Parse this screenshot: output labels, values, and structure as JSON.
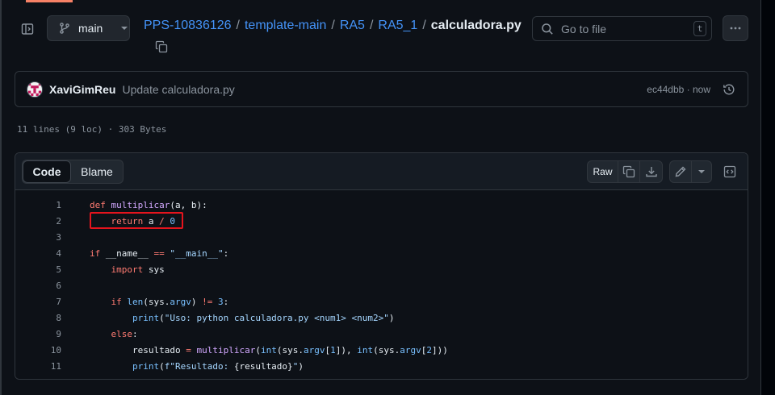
{
  "header": {
    "branch": "main",
    "breadcrumb": {
      "repo": "PPS-10836126",
      "path": [
        "template-main",
        "RA5",
        "RA5_1"
      ],
      "file": "calculadora.py",
      "separator": "/"
    },
    "search": {
      "placeholder": "Go to file",
      "shortcut": "t"
    },
    "icons": [
      "sidebar-expand-icon",
      "git-branch-icon",
      "copy-icon",
      "search-icon",
      "kebab-horizontal-icon"
    ]
  },
  "commit": {
    "author": "XaviGimReu",
    "message": "Update calculadora.py",
    "meta": "ec44dbb · now"
  },
  "file_info": "11 lines (9 loc) · 303 Bytes",
  "code_view": {
    "tabs": {
      "code": "Code",
      "blame": "Blame"
    },
    "raw_label": "Raw",
    "lines": [
      {
        "n": "1",
        "tokens": [
          {
            "t": "def ",
            "c": "k"
          },
          {
            "t": "multiplicar",
            "c": "f"
          },
          {
            "t": "(a, b):",
            "c": ""
          }
        ]
      },
      {
        "n": "2",
        "tokens": [
          {
            "t": "    return",
            "c": "k"
          },
          {
            "t": " a ",
            "c": ""
          },
          {
            "t": "/",
            "c": "k"
          },
          {
            "t": " ",
            "c": ""
          },
          {
            "t": "0",
            "c": "c"
          }
        ]
      },
      {
        "n": "3",
        "tokens": []
      },
      {
        "n": "4",
        "tokens": [
          {
            "t": "if",
            "c": "k"
          },
          {
            "t": " __name__ ",
            "c": ""
          },
          {
            "t": "==",
            "c": "k"
          },
          {
            "t": " ",
            "c": ""
          },
          {
            "t": "\"__main__\"",
            "c": "s"
          },
          {
            "t": ":",
            "c": ""
          }
        ]
      },
      {
        "n": "5",
        "tokens": [
          {
            "t": "    import",
            "c": "k"
          },
          {
            "t": " sys",
            "c": ""
          }
        ]
      },
      {
        "n": "6",
        "tokens": []
      },
      {
        "n": "7",
        "tokens": [
          {
            "t": "    if",
            "c": "k"
          },
          {
            "t": " ",
            "c": ""
          },
          {
            "t": "len",
            "c": "c"
          },
          {
            "t": "(sys.",
            "c": ""
          },
          {
            "t": "argv",
            "c": "c"
          },
          {
            "t": ") ",
            "c": ""
          },
          {
            "t": "!=",
            "c": "k"
          },
          {
            "t": " ",
            "c": ""
          },
          {
            "t": "3",
            "c": "c"
          },
          {
            "t": ":",
            "c": ""
          }
        ]
      },
      {
        "n": "8",
        "tokens": [
          {
            "t": "        ",
            "c": ""
          },
          {
            "t": "print",
            "c": "c"
          },
          {
            "t": "(",
            "c": ""
          },
          {
            "t": "\"Uso: python calculadora.py <num1> <num2>\"",
            "c": "s"
          },
          {
            "t": ")",
            "c": ""
          }
        ]
      },
      {
        "n": "9",
        "tokens": [
          {
            "t": "    else",
            "c": "k"
          },
          {
            "t": ":",
            "c": ""
          }
        ]
      },
      {
        "n": "10",
        "tokens": [
          {
            "t": "        resultado ",
            "c": ""
          },
          {
            "t": "=",
            "c": "k"
          },
          {
            "t": " ",
            "c": ""
          },
          {
            "t": "multiplicar",
            "c": "f"
          },
          {
            "t": "(",
            "c": ""
          },
          {
            "t": "int",
            "c": "c"
          },
          {
            "t": "(sys.",
            "c": ""
          },
          {
            "t": "argv",
            "c": "c"
          },
          {
            "t": "[",
            "c": ""
          },
          {
            "t": "1",
            "c": "c"
          },
          {
            "t": "]), ",
            "c": ""
          },
          {
            "t": "int",
            "c": "c"
          },
          {
            "t": "(sys.",
            "c": ""
          },
          {
            "t": "argv",
            "c": "c"
          },
          {
            "t": "[",
            "c": ""
          },
          {
            "t": "2",
            "c": "c"
          },
          {
            "t": "]))",
            "c": ""
          }
        ]
      },
      {
        "n": "11",
        "tokens": [
          {
            "t": "        ",
            "c": ""
          },
          {
            "t": "print",
            "c": "c"
          },
          {
            "t": "(",
            "c": ""
          },
          {
            "t": "f\"Resultado: ",
            "c": "s"
          },
          {
            "t": "{resultado}",
            "c": ""
          },
          {
            "t": "\"",
            "c": "s"
          },
          {
            "t": ")",
            "c": ""
          }
        ]
      }
    ]
  },
  "colors": {
    "accent_link": "#4493f8",
    "highlight_box": "#e5141d",
    "keyword": "#ff7b72",
    "function": "#d2a8ff",
    "string": "#a5d6ff",
    "constant": "#79c0ff"
  }
}
